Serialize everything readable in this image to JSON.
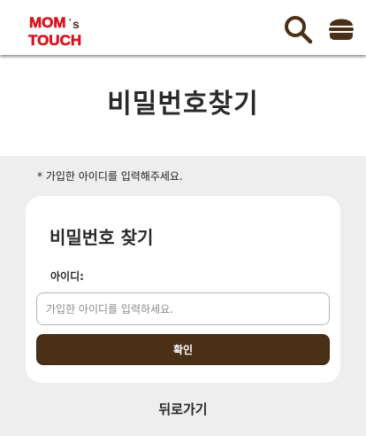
{
  "brand": {
    "logo_line1": "MOM's",
    "logo_line2": "TOUCH",
    "logo_color": "#d7141e",
    "accent_color": "#4b3018"
  },
  "header": {
    "search_icon": "search-icon",
    "menu_icon": "burger-menu-icon"
  },
  "page": {
    "title": "비밀번호찾기",
    "notice": "* 가입한 아이디를 입력해주세요."
  },
  "form": {
    "title": "비밀번호 찾기",
    "id_label": "아이디:",
    "id_value": "",
    "id_placeholder": "가입한 아이디를 입력하세요.",
    "confirm_label": "확인"
  },
  "footer": {
    "back_label": "뒤로가기"
  }
}
